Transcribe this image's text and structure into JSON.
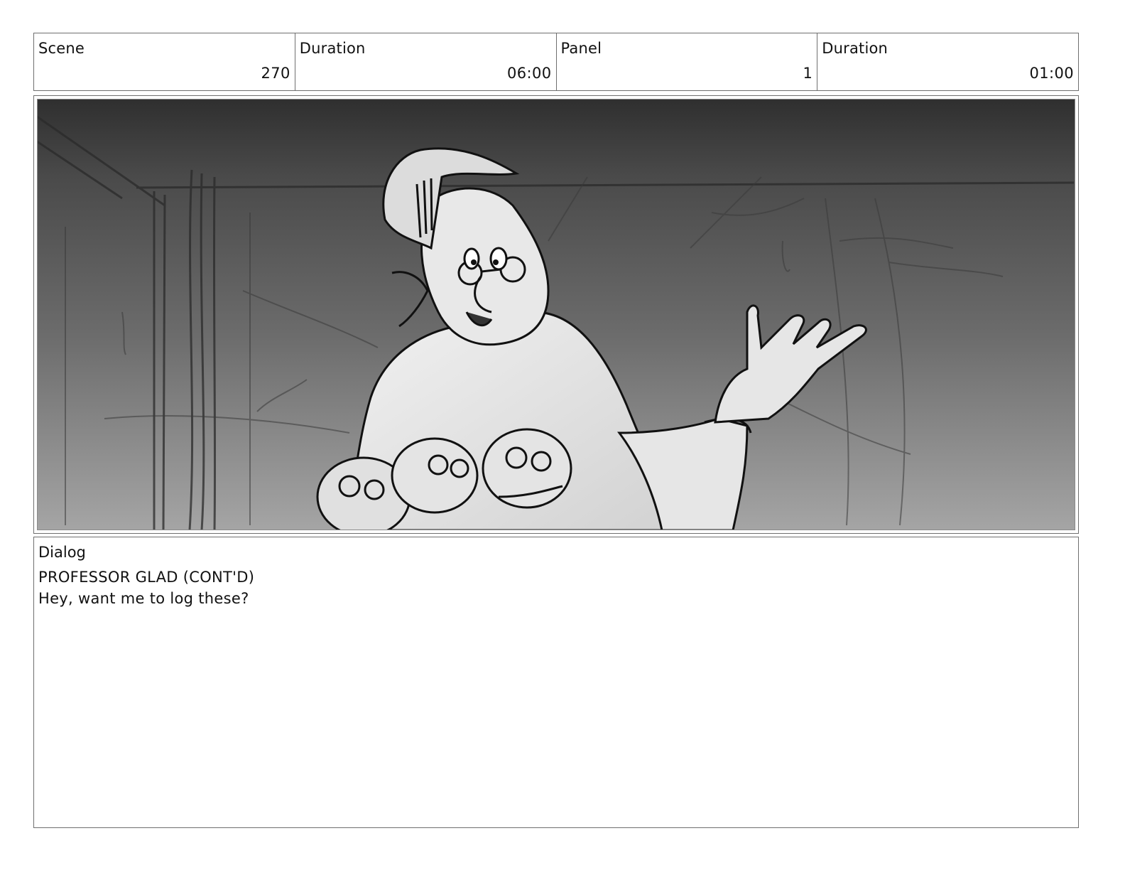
{
  "header": {
    "cells": [
      {
        "label": "Scene",
        "value": "270"
      },
      {
        "label": "Duration",
        "value": "06:00"
      },
      {
        "label": "Panel",
        "value": "1"
      },
      {
        "label": "Duration",
        "value": "01:00"
      }
    ]
  },
  "panel": {
    "icon": "storyboard-sketch-professor"
  },
  "dialog": {
    "label": "Dialog",
    "lines": [
      "PROFESSOR GLAD (CONT'D)",
      "Hey, want me to log these?"
    ]
  }
}
